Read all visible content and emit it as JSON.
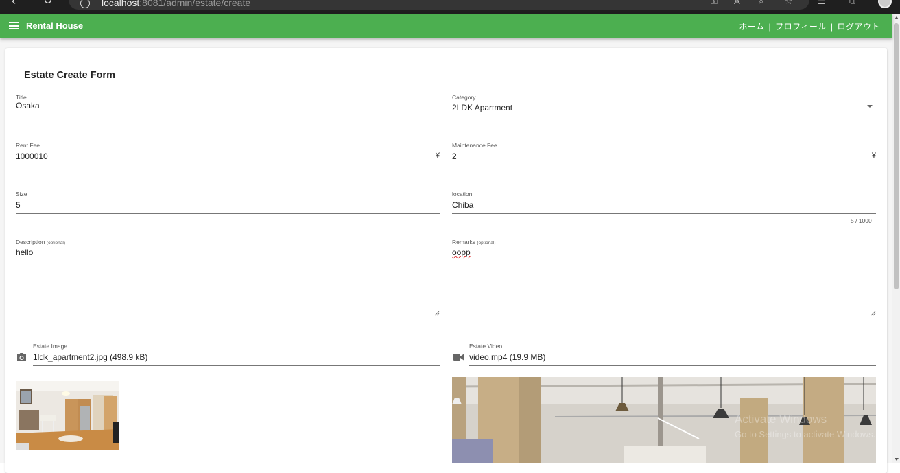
{
  "browser": {
    "url_host": "localhost",
    "url_rest": ":8081/admin/estate/create"
  },
  "appbar": {
    "title": "Rental House",
    "links": [
      "ホーム",
      "プロフィール",
      "ログアウト"
    ],
    "separator": "|"
  },
  "form": {
    "title": "Estate Create Form",
    "title_field": {
      "label": "Title",
      "value": "Osaka"
    },
    "category": {
      "label": "Category",
      "value": "2LDK Apartment"
    },
    "rent_fee": {
      "label": "Rent Fee",
      "value": "1000010",
      "suffix": "¥"
    },
    "maintenance_fee": {
      "label": "Maintenance Fee",
      "value": "2",
      "suffix": "¥"
    },
    "size": {
      "label": "Size",
      "value": "5"
    },
    "location": {
      "label": "location",
      "value": "Chiba",
      "counter": "5 / 1000"
    },
    "description": {
      "label": "Description",
      "optional": "(optional)",
      "value": "hello"
    },
    "remarks": {
      "label": "Remarks",
      "optional": "(optional)",
      "value": "oopp"
    },
    "estate_image": {
      "label": "Estate Image",
      "value": "1ldk_apartment2.jpg (498.9 kB)",
      "icon": "camera-icon"
    },
    "estate_video": {
      "label": "Estate Video",
      "value": "video.mp4 (19.9 MB)",
      "icon": "video-camera-icon"
    }
  },
  "watermark": {
    "line1": "Activate Windows",
    "line2": "Go to Settings to activate Windows."
  },
  "colors": {
    "appbar": "#4caf50",
    "underline": "#777777"
  }
}
